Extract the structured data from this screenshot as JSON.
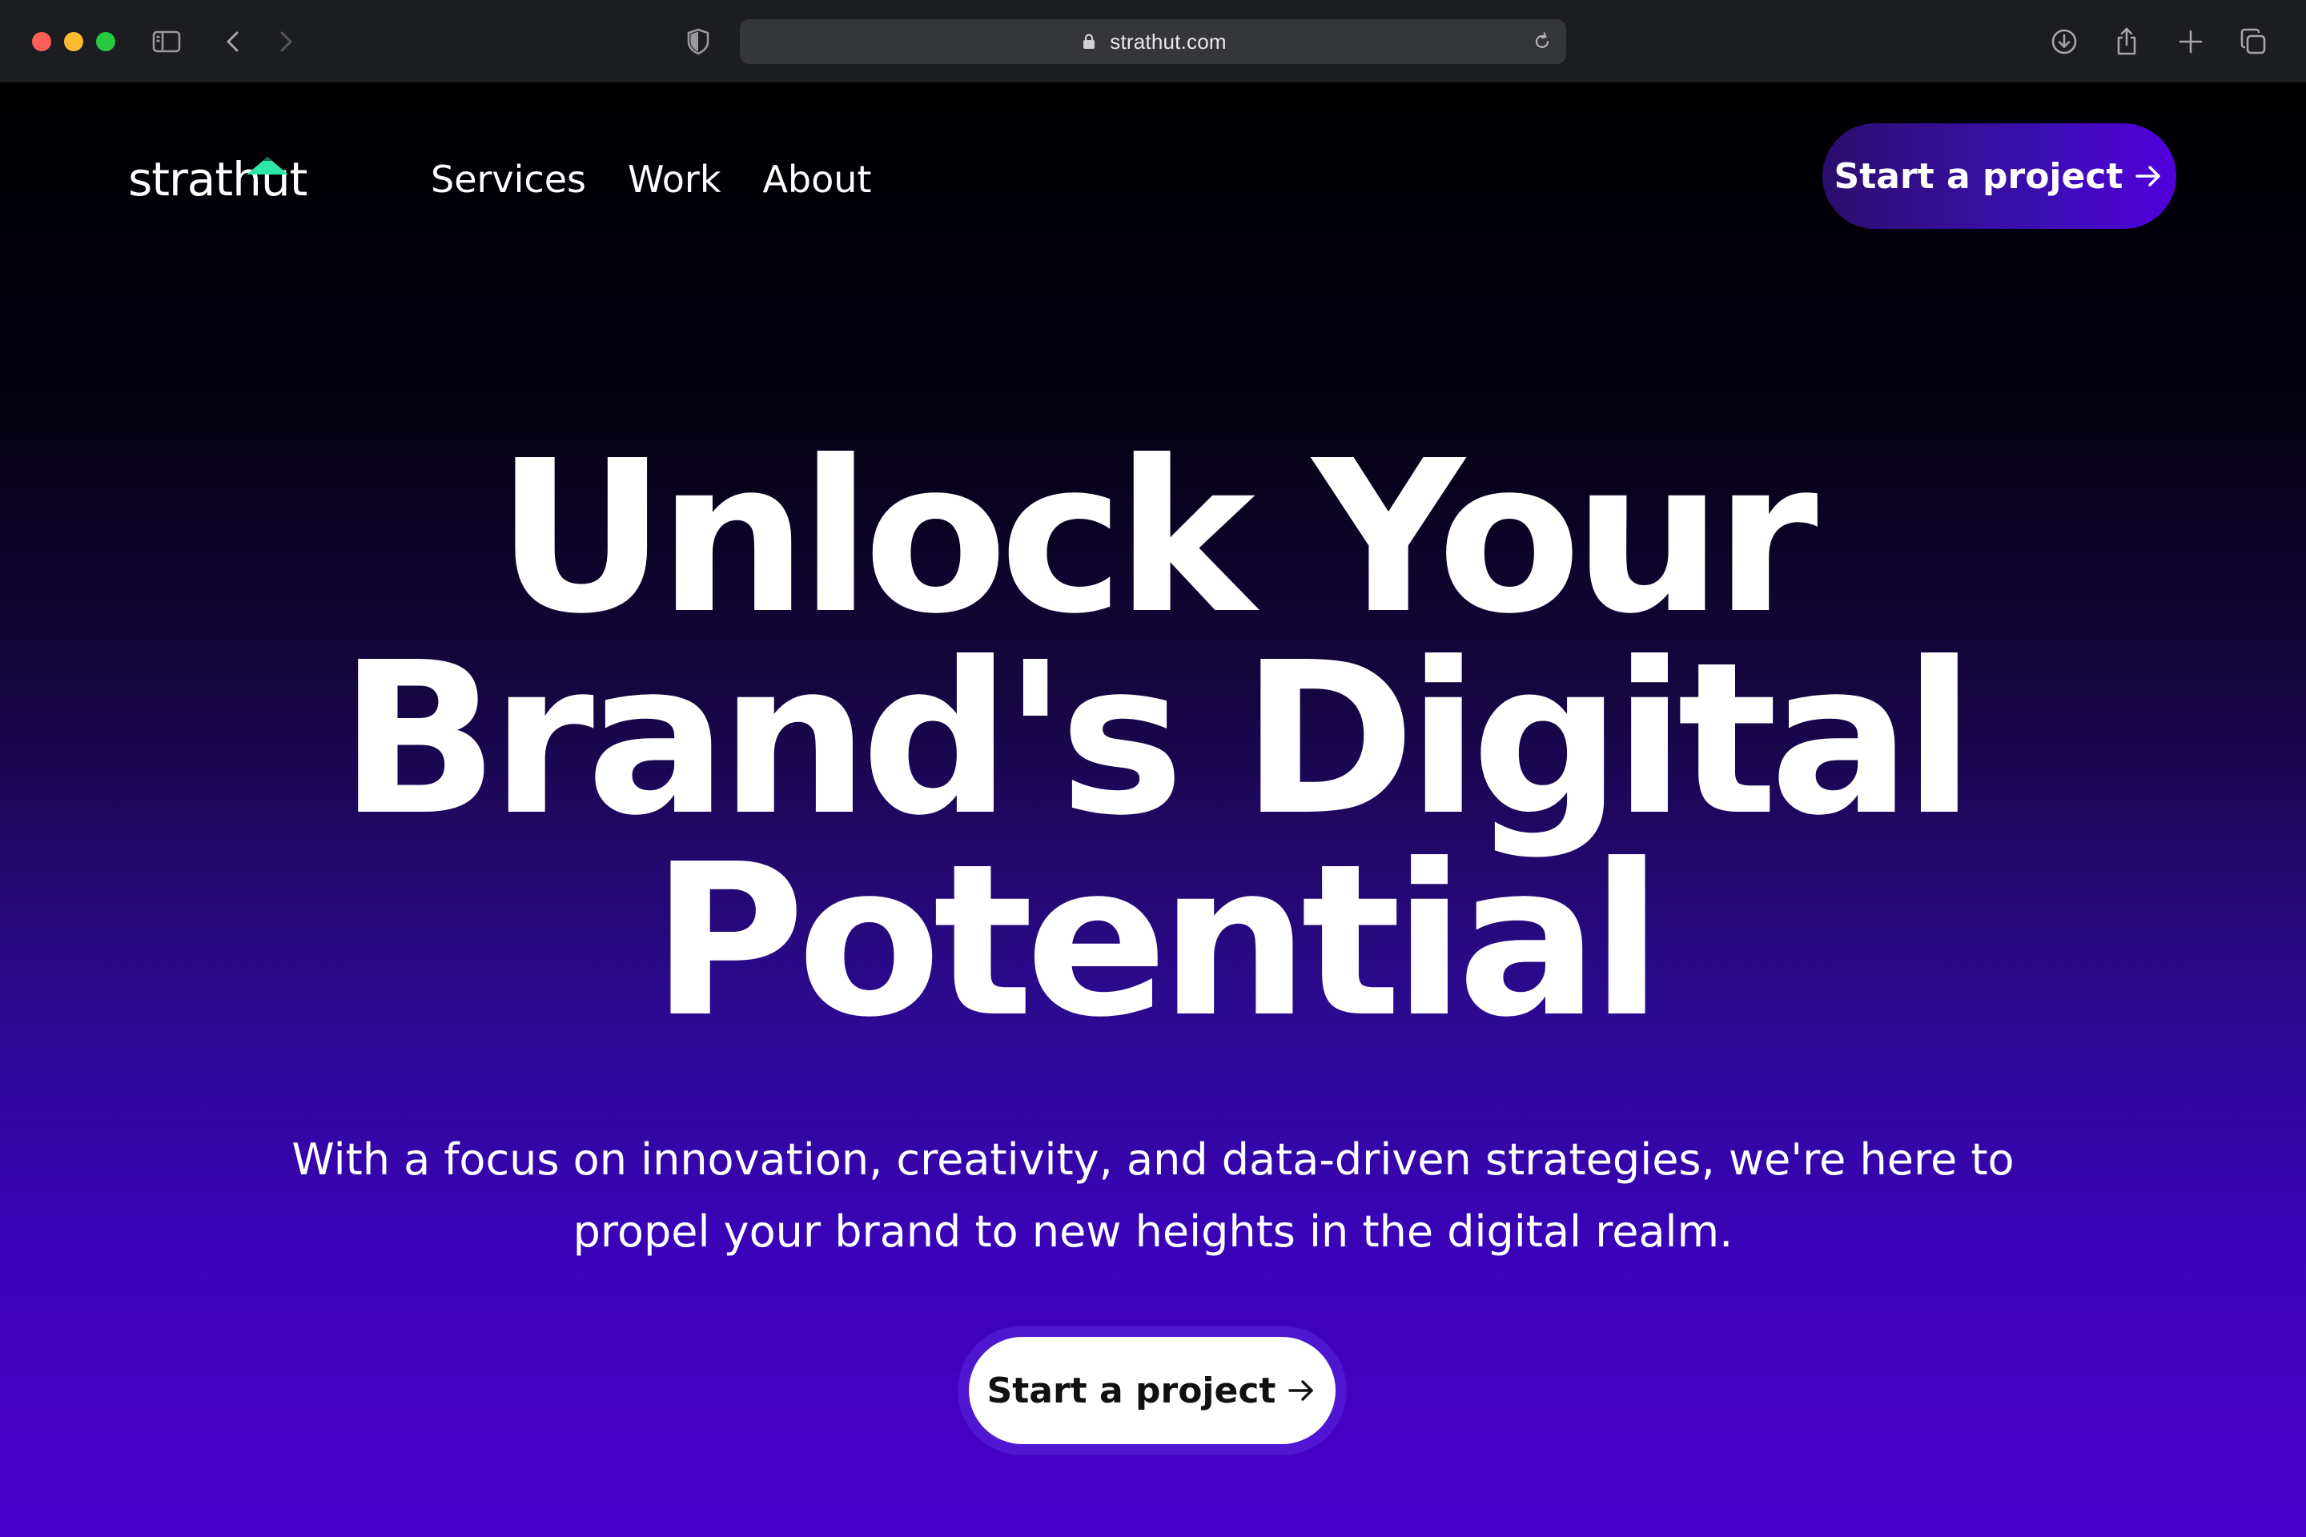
{
  "browser": {
    "url": "strathut.com",
    "icons": {
      "sidebar": "sidebar-icon",
      "back": "chevron-left-icon",
      "forward": "chevron-right-icon",
      "shield": "shield-icon",
      "lock": "lock-icon",
      "reload": "reload-icon",
      "download": "download-icon",
      "share": "share-icon",
      "new_tab": "plus-icon",
      "tabs": "tabs-overview-icon"
    }
  },
  "site": {
    "logo_text": "strathut",
    "logo_accent_color": "#2ee6a6",
    "nav": [
      {
        "label": "Services"
      },
      {
        "label": "Work"
      },
      {
        "label": "About"
      }
    ],
    "header_cta": "Start a project"
  },
  "hero": {
    "title_lines": [
      "Unlock Your",
      "Brand's Digital",
      "Potential"
    ],
    "subtitle_lines": [
      "With a focus on innovation, creativity, and data-driven strategies, we're here to",
      "propel your brand to new heights in the digital realm."
    ],
    "cta": "Start a project"
  },
  "colors": {
    "gradient_top": "#000000",
    "gradient_bottom": "#4a00cc",
    "cta_top_start": "#2b0e6e",
    "cta_top_end": "#5200dd"
  }
}
